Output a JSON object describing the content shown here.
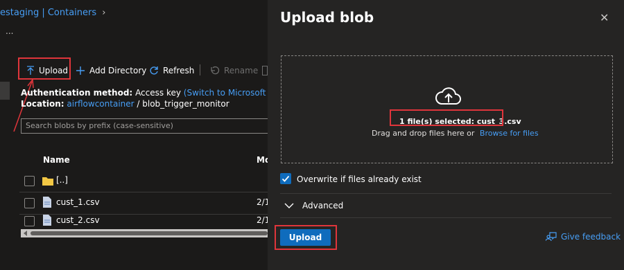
{
  "breadcrumb": {
    "text": "estaging | Containers",
    "chevron": "›"
  },
  "more_menu": "...",
  "toolbar": {
    "upload_label": "Upload",
    "add_directory_label": "Add Directory",
    "refresh_label": "Refresh",
    "rename_label": "Rename"
  },
  "info": {
    "auth_label": "Authentication method:",
    "auth_value": "Access key",
    "auth_switch_link": "(Switch to Microsoft Entra user a",
    "location_label": "Location:",
    "location_link": "airflowcontainer",
    "location_path": "/ blob_trigger_monitor"
  },
  "search": {
    "placeholder": "Search blobs by prefix (case-sensitive)"
  },
  "table": {
    "col_name": "Name",
    "col_modified": "Mo",
    "rows": [
      {
        "name": "[..]",
        "modified": "",
        "type": "folder"
      },
      {
        "name": "cust_1.csv",
        "modified": "2/1",
        "type": "file"
      },
      {
        "name": "cust_2.csv",
        "modified": "2/1",
        "type": "file"
      }
    ]
  },
  "panel": {
    "title": "Upload blob",
    "close": "✕",
    "selected_text": "1 file(s) selected: cust_3.csv",
    "drag_text": "Drag and drop files here  or",
    "browse_link": "Browse for files",
    "overwrite_label": "Overwrite if files already exist",
    "overwrite_checked": true,
    "advanced_label": "Advanced",
    "upload_button": "Upload",
    "feedback_link": "Give feedback"
  },
  "colors": {
    "accent": "#0f6cbd",
    "link": "#479ef5",
    "highlight": "#e0353b",
    "panel_bg": "#252423",
    "page_bg": "#1b1a19"
  }
}
